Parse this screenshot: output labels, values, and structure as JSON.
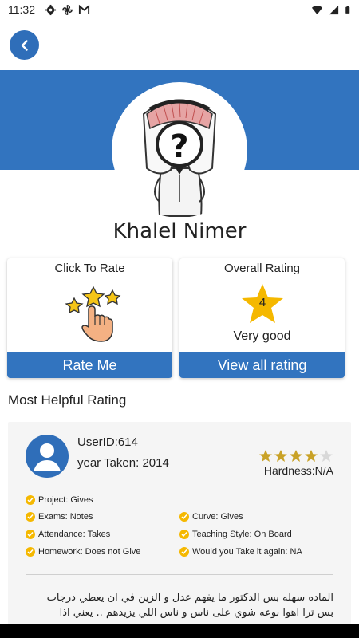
{
  "status_bar": {
    "time": "11:32",
    "icons_left": [
      "gear-icon",
      "pinwheel-icon",
      "gmail-icon"
    ],
    "icons_right": [
      "wifi-icon",
      "signal-icon",
      "battery-icon"
    ]
  },
  "header": {
    "back_icon": "chevron-left-icon",
    "accent_color": "#3274bf"
  },
  "profile": {
    "name": "Khalel Nimer"
  },
  "rate_card": {
    "title": "Click To Rate",
    "button_label": "Rate Me"
  },
  "overall_card": {
    "title": "Overall Rating",
    "score": "4",
    "description": "Very good",
    "button_label": "View all rating"
  },
  "section": {
    "title": "Most Helpful Rating"
  },
  "review": {
    "user_id": "UserID:614",
    "year_taken": "year Taken: 2014",
    "stars": 4,
    "stars_max": 5,
    "hardness": "Hardness:N/A",
    "tags": [
      "Project: Gives",
      "Exams: Notes",
      "Curve: Gives",
      "Attendance: Takes",
      "Teaching Style: On Board",
      "Homework: Does not Give",
      "Would you Take it again: NA"
    ],
    "comment_line1": "الماده سهله بس الدكتور ما يفهم عدل و الزين في ان يعطي درجات",
    "comment_line2": "بس ترا اهوا نوعه شوي على ناس و ناس اللي يزيدهم .. يعني اذا"
  }
}
